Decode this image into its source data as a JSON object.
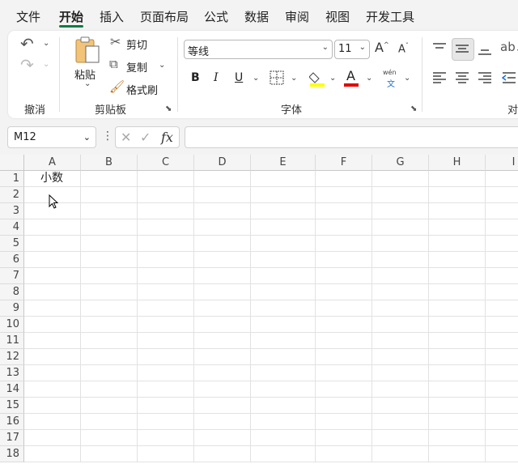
{
  "menu": {
    "tabs": [
      "文件",
      "开始",
      "插入",
      "页面布局",
      "公式",
      "数据",
      "审阅",
      "视图",
      "开发工具"
    ],
    "active": "开始"
  },
  "ribbon": {
    "undo_group": "撤消",
    "clipboard": {
      "paste": "粘贴",
      "cut": "剪切",
      "copy": "复制",
      "format_painter": "格式刷",
      "label": "剪贴板"
    },
    "font": {
      "name": "等线",
      "size": "11",
      "bold": "B",
      "italic": "I",
      "underline": "U",
      "font_color": "A",
      "phonetic_top": "wén",
      "phonetic_bottom": "文",
      "label": "字体"
    },
    "align_label_partial": "对"
  },
  "formula_bar": {
    "name_box": "M12",
    "fx": "fx",
    "formula": ""
  },
  "sheet": {
    "columns": [
      "A",
      "B",
      "C",
      "D",
      "E",
      "F",
      "G",
      "H",
      "I"
    ],
    "rows": [
      "1",
      "2",
      "3",
      "4",
      "5",
      "6",
      "7",
      "8",
      "9",
      "10",
      "11",
      "12",
      "13",
      "14",
      "15",
      "16",
      "17",
      "18"
    ],
    "cells": {
      "A1": "小数"
    }
  }
}
